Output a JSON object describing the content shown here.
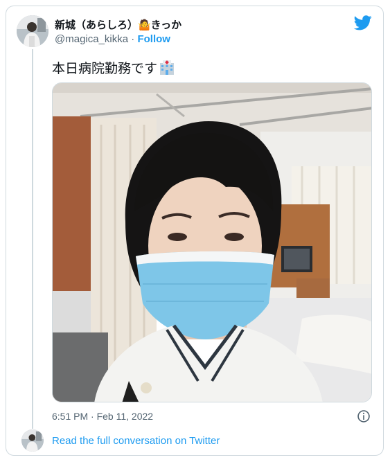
{
  "tweet": {
    "display_name": "新城（あらしろ）🤷きっか",
    "handle": "@magica_kikka",
    "separator": "·",
    "follow_label": "Follow",
    "text": "本日病院勤務です",
    "timestamp": "6:51 PM · Feb 11, 2022",
    "read_more_label": "Read the full conversation on Twitter"
  },
  "icons": {
    "brand": "twitter-bird-icon",
    "info": "info-icon",
    "emoji": "hospital-emoji-icon"
  },
  "colors": {
    "accent": "#1d9bf0",
    "text": "#0f1419",
    "secondary": "#536471",
    "border": "#cfd9de"
  }
}
